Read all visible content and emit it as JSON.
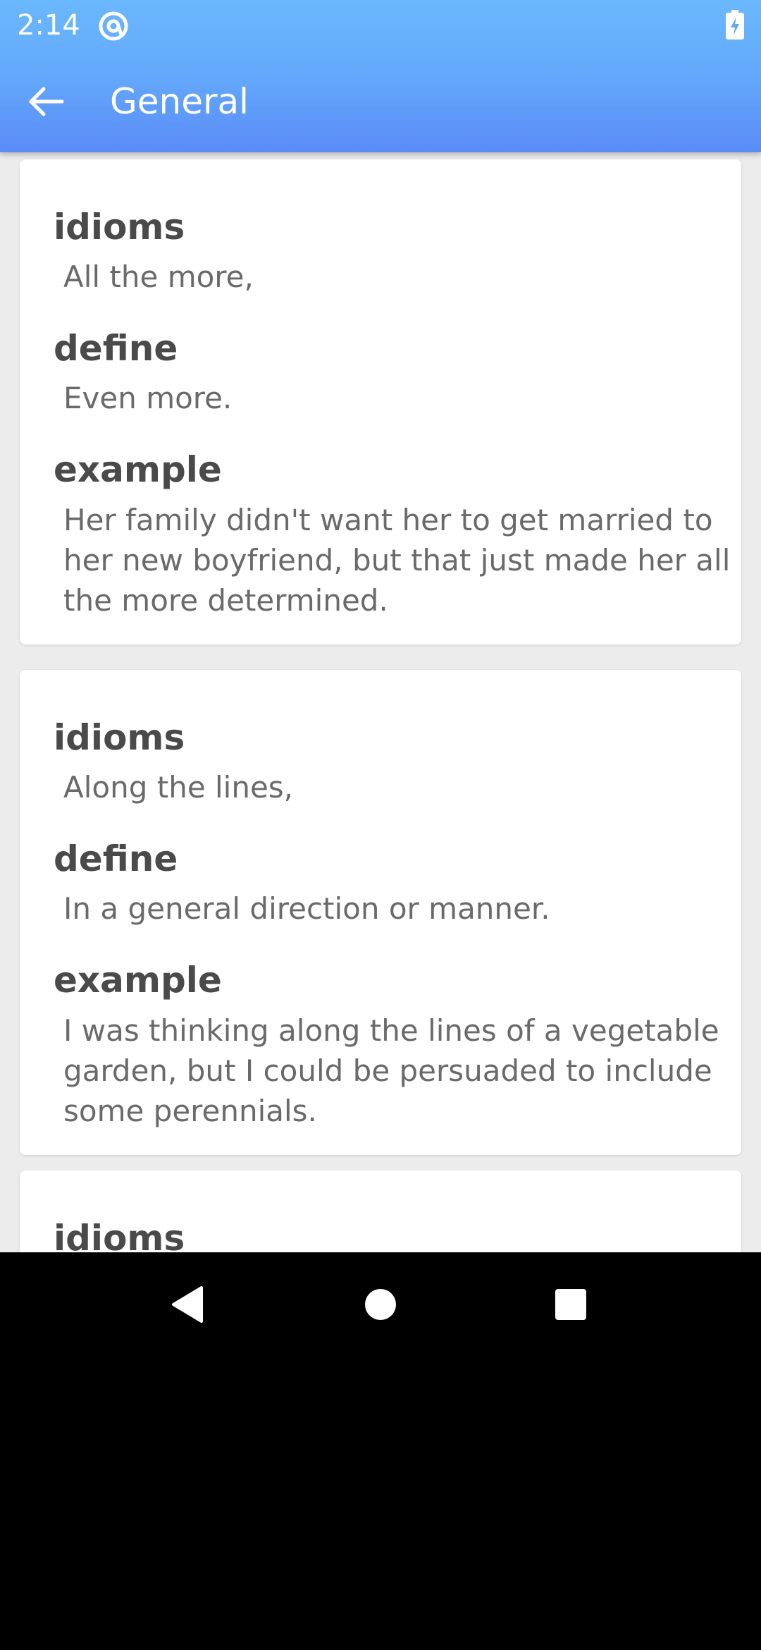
{
  "status_bar": {
    "time": "2:14"
  },
  "toolbar": {
    "title": "General"
  },
  "cards": [
    {
      "idiom_label": "idioms",
      "idiom": " All the more,",
      "define_label": "define",
      "define": " Even more.",
      "example_label": "example",
      "example": " Her family didn't want her to get married to her new boyfriend, but that just made her all the more determined."
    },
    {
      "idiom_label": "idioms",
      "idiom": " Along the lines,",
      "define_label": "define",
      "define": " In a general direction or manner.",
      "example_label": "example",
      "example": " I was thinking along the lines of a vegetable garden, but I could be persuaded to include some perennials."
    },
    {
      "idiom_label": "idioms"
    }
  ],
  "icons": {
    "status_app": "at-sign-icon",
    "battery": "battery-charging-icon",
    "back": "arrow-back-icon",
    "nav_back": "triangle-back-icon",
    "nav_home": "circle-home-icon",
    "nav_recents": "square-recents-icon"
  },
  "colors": {
    "appbar_top": "#6ab8fd",
    "appbar_bottom": "#5a8cf7",
    "background": "#ececec",
    "card": "#ffffff",
    "label_text": "#4a4a4a",
    "value_text": "#6a6a6a"
  }
}
